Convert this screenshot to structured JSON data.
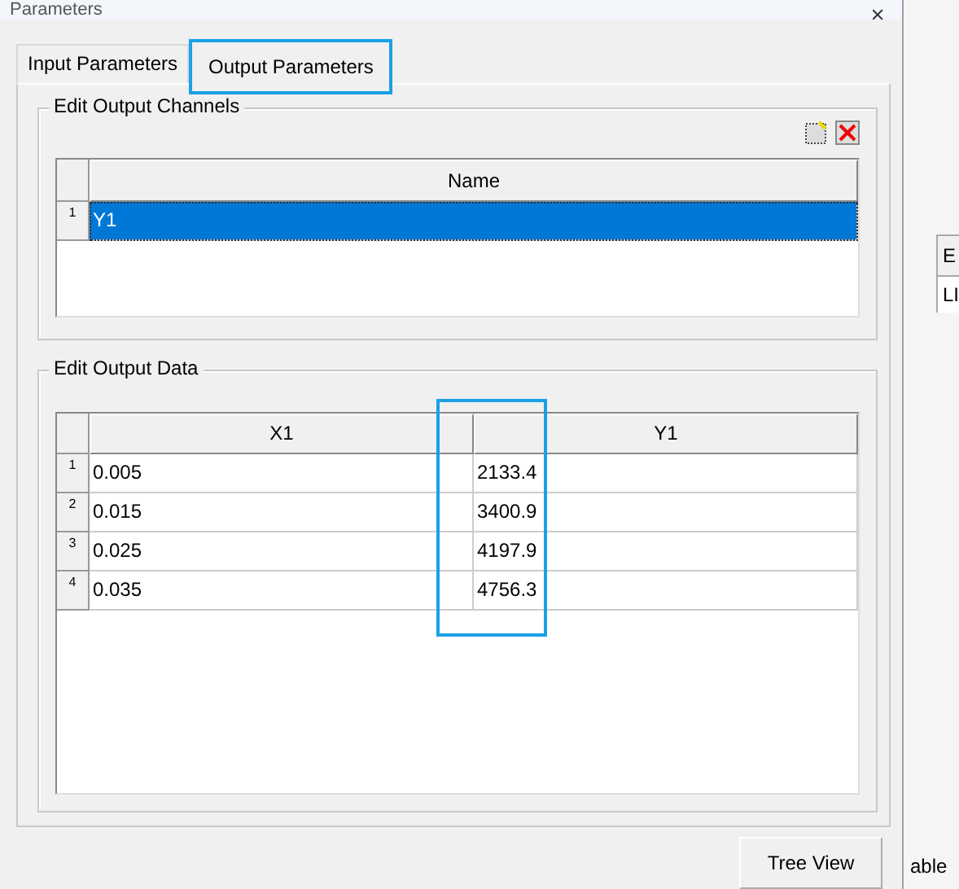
{
  "window": {
    "title": "Parameters"
  },
  "tabs": [
    {
      "label": "Input Parameters",
      "selected": false
    },
    {
      "label": "Output Parameters",
      "selected": true
    }
  ],
  "channels_group": {
    "title": "Edit Output Channels",
    "columns": [
      "Name"
    ],
    "rows": [
      {
        "index": "1",
        "name": "Y1",
        "selected": true
      }
    ]
  },
  "data_group": {
    "title": "Edit Output Data",
    "columns": [
      "X1",
      "Y1"
    ],
    "rows": [
      {
        "index": "1",
        "cells": [
          "0.005",
          "2133.4"
        ]
      },
      {
        "index": "2",
        "cells": [
          "0.015",
          "3400.9"
        ]
      },
      {
        "index": "3",
        "cells": [
          "0.025",
          "4197.9"
        ]
      },
      {
        "index": "4",
        "cells": [
          "0.035",
          "4756.3"
        ]
      }
    ]
  },
  "buttons": [
    "Tree View"
  ],
  "background": {
    "column_header": "E",
    "cell": "LI",
    "label": "able"
  }
}
